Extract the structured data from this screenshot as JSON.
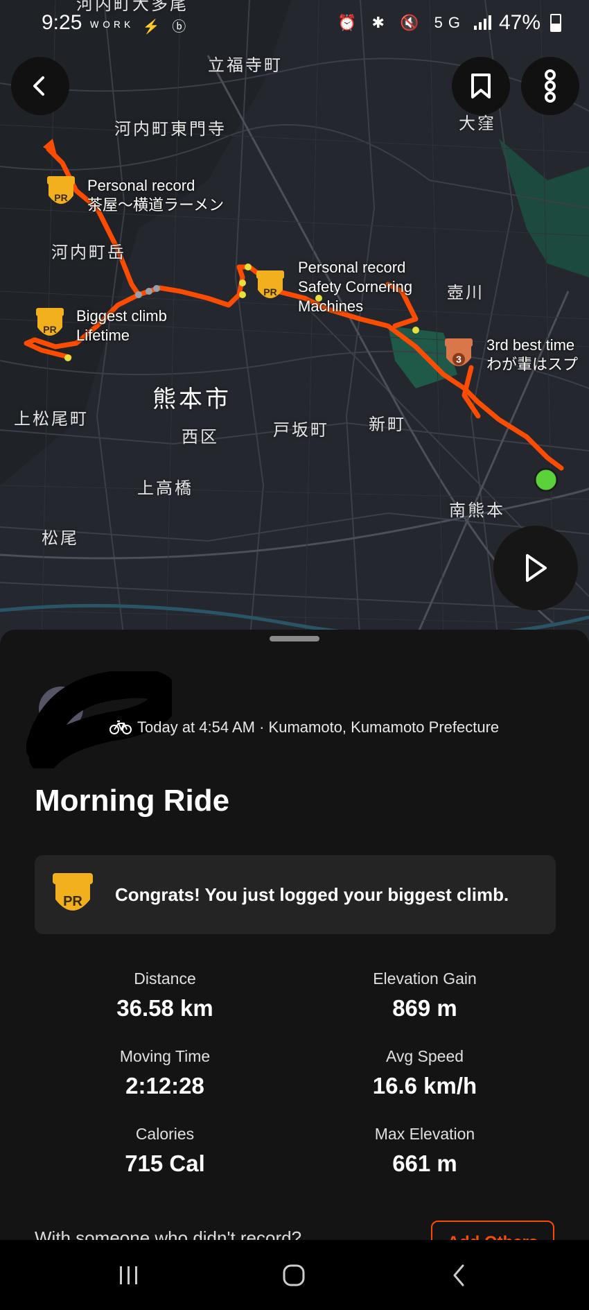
{
  "status_bar": {
    "time": "9:25",
    "app_icons": "ᵂᴼᴿᴷ ⚡ ⓑ",
    "system_icons": "⏰ ✱ 🔇 5G",
    "battery": "47%"
  },
  "map": {
    "place_labels": [
      {
        "text": "河内町大多尾",
        "key": "kawachi-ootao"
      },
      {
        "text": "立福寺町"
      },
      {
        "text": "河内町東門寺"
      },
      {
        "text": "大窪"
      },
      {
        "text": "河内町岳"
      },
      {
        "text": "壺川"
      },
      {
        "text": "熊本市"
      },
      {
        "text": "上松尾町"
      },
      {
        "text": "西区"
      },
      {
        "text": "戸坂町"
      },
      {
        "text": "新町"
      },
      {
        "text": "上高橋"
      },
      {
        "text": "南熊本"
      },
      {
        "text": "松尾"
      }
    ],
    "segments": [
      {
        "line1": "Personal record",
        "line2": "茶屋〜横道ラーメン",
        "badge": "PR"
      },
      {
        "line1": "Personal record",
        "line2": "Safety Cornering",
        "line3": "Machines",
        "badge": "PR"
      },
      {
        "line1": "Biggest climb",
        "line2": "Lifetime",
        "badge": "PR"
      },
      {
        "line1": "3rd best time",
        "line2": "わが輩はスプ",
        "badge": "3"
      }
    ],
    "route_color": "#fc4c02",
    "badge_color": "#f2b01e"
  },
  "activity": {
    "meta": "Today at 4:54 AM · Kumamoto, Kumamoto Prefecture",
    "title": "Morning Ride",
    "congrats": "Congrats! You just logged your biggest climb.",
    "badge_text": "PR",
    "stats": [
      {
        "label": "Distance",
        "value": "36.58 km"
      },
      {
        "label": "Elevation Gain",
        "value": "869 m"
      },
      {
        "label": "Moving Time",
        "value": "2:12:28"
      },
      {
        "label": "Avg Speed",
        "value": "16.6 km/h"
      },
      {
        "label": "Calories",
        "value": "715 Cal"
      },
      {
        "label": "Max Elevation",
        "value": "661 m"
      }
    ],
    "with_someone_prompt": "With someone who didn't record?",
    "add_others_label": "Add Others"
  },
  "icons": {
    "back": "chevron-left-icon",
    "bookmark": "bookmark-icon",
    "more": "more-vertical-icon",
    "play": "play-icon",
    "bike": "bike-icon"
  }
}
